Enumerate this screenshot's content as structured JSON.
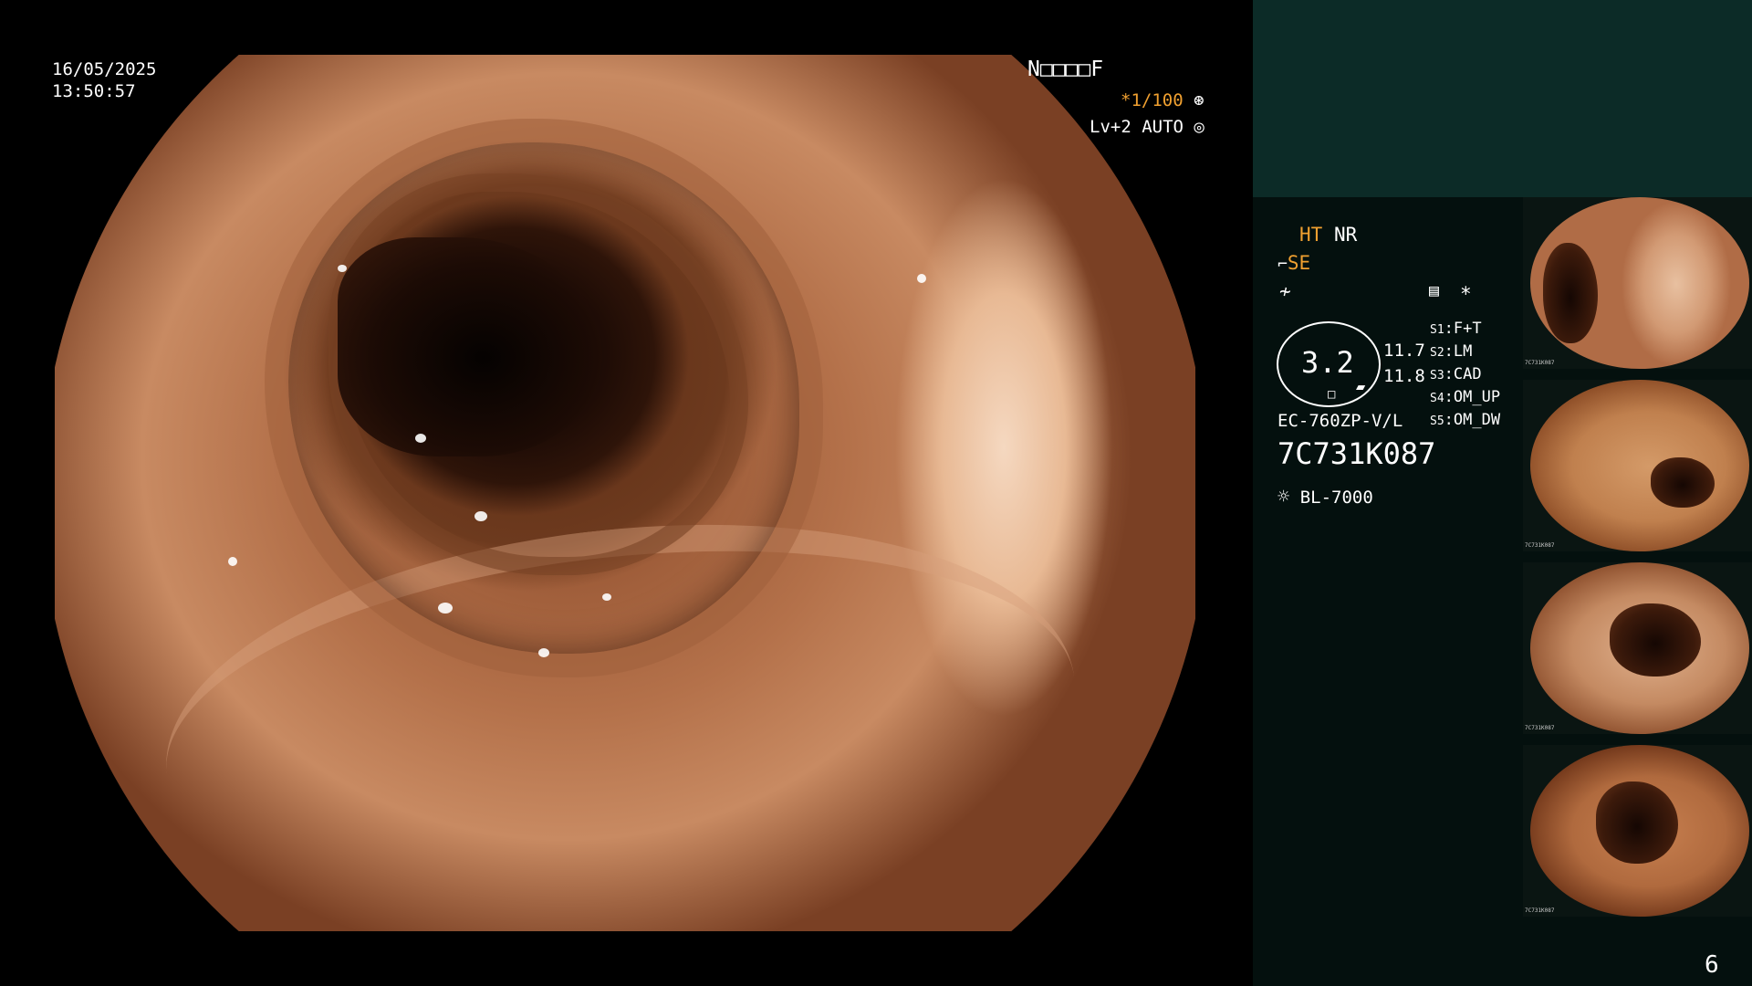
{
  "overlay": {
    "date": "16/05/2025",
    "time": "13:50:57",
    "mode_code": "N□□□□F",
    "shutter": "*1/100",
    "shutter_icon": "shutter-icon",
    "level": "Lv+2 AUTO",
    "level_icon": "auto-iris-icon"
  },
  "sidebar": {
    "enhance_primary": "HT",
    "enhance_secondary": "NR",
    "structure": "SE",
    "structure_icon": "structure-icon",
    "color_icon": "color-tone-icon",
    "settings_icon": "settings-icon",
    "asterisk": "*",
    "zoom_value": "3.2",
    "readout_1": "11.7",
    "readout_2": "11.8",
    "scope_model": "EC-760ZP-V/L",
    "scope_serial": "7C731K087",
    "light_source": "BL-7000",
    "light_icon": "light-source-icon",
    "switches": [
      {
        "key": "S1",
        "value": "F+T"
      },
      {
        "key": "S2",
        "value": "LM"
      },
      {
        "key": "S3",
        "value": "CAD"
      },
      {
        "key": "S4",
        "value": "OM_UP"
      },
      {
        "key": "S5",
        "value": "OM_DW"
      }
    ],
    "capture_count": "6"
  },
  "thumbnails": [
    {
      "label": "capture-1",
      "serial": "7C731K087"
    },
    {
      "label": "capture-2",
      "serial": "7C731K087"
    },
    {
      "label": "capture-3",
      "serial": "7C731K087"
    },
    {
      "label": "capture-4",
      "serial": "7C731K087"
    }
  ],
  "colors": {
    "background": "#000000",
    "sidebar": "#04100e",
    "sidebar_band": "#0c2b27",
    "accent": "#f0a030"
  }
}
